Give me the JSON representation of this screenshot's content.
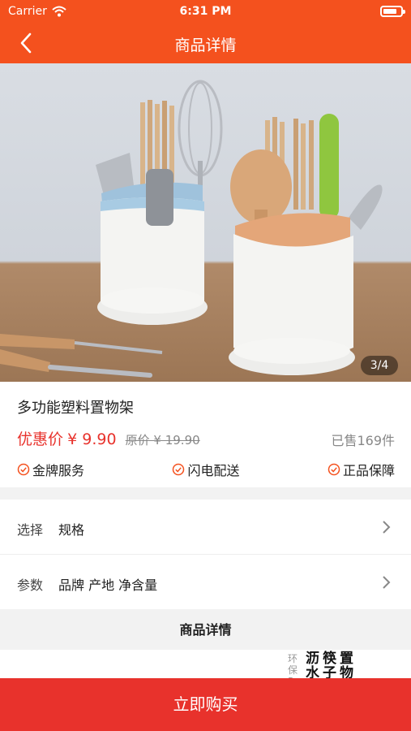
{
  "status_bar": {
    "carrier": "Carrier",
    "time": "6:31 PM"
  },
  "nav": {
    "title": "商品详情"
  },
  "gallery": {
    "counter": "3/4"
  },
  "product": {
    "name": "多功能塑料置物架",
    "price_label": "优惠价",
    "price": "¥ 9.90",
    "original_price": "原价 ¥ 19.90",
    "sold": "已售169件",
    "badges": [
      "金牌服务",
      "闪电配送",
      "正品保障"
    ]
  },
  "options": {
    "select_label": "选择",
    "select_value": "规格",
    "params_label": "参数",
    "params_value": "品牌 产地 净含量"
  },
  "detail": {
    "header": "商品详情",
    "img_text_small": "环保PP",
    "img_text_big": "沥筷置 水子物"
  },
  "bottom": {
    "buy_label": "立即购买"
  },
  "colors": {
    "brand": "#f4511e",
    "buy": "#e8322c",
    "price": "#e8322c"
  }
}
